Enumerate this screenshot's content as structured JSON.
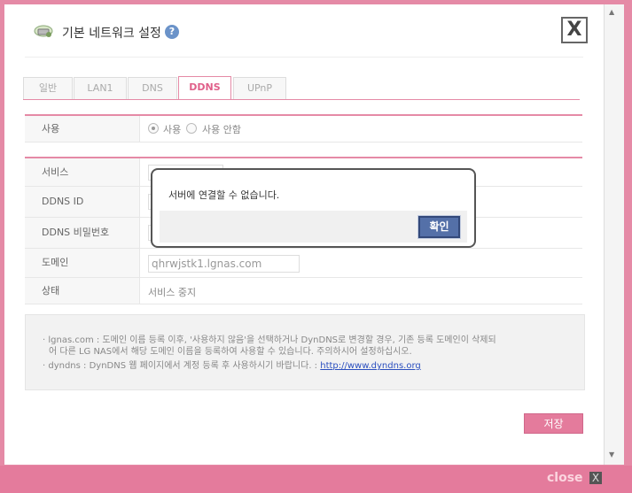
{
  "window": {
    "title": "기본 네트워크 설정",
    "help_label": "?",
    "close_x_label": "X",
    "footer_close_label": "close",
    "footer_close_x_label": "X"
  },
  "tabs": [
    {
      "label": "일반",
      "active": false
    },
    {
      "label": "LAN1",
      "active": false
    },
    {
      "label": "DNS",
      "active": false
    },
    {
      "label": "DDNS",
      "active": true
    },
    {
      "label": "UPnP",
      "active": false
    }
  ],
  "usage": {
    "label": "사용",
    "options": [
      {
        "label": "사용",
        "selected": true
      },
      {
        "label": "사용 안함",
        "selected": false
      }
    ]
  },
  "fields": {
    "service_label": "서비스",
    "ddns_id_label": "DDNS ID",
    "ddns_password_label": "DDNS 비밀번호",
    "domain_label": "도메인",
    "domain_value": "qhrwjstk1.lgnas.com",
    "status_label": "상태",
    "status_value": "서비스 중지"
  },
  "notes": {
    "note1_line1": "· lgnas.com : 도메인 이름 등록 이후, '사용하지 않음'을 선택하거나 DynDNS로 변경할 경우, 기존 등록 도메인이 삭제되",
    "note1_line2": "어 다른 LG NAS에서 해당 도메인 이름을 등록하여 사용할 수 있습니다. 주의하시어 설정하십시오.",
    "note2_text": "· dyndns : DynDNS 웹 페이지에서 계정 등록 후 사용하시기 바랍니다. : ",
    "note2_link": "http://www.dyndns.org"
  },
  "save_label": "저장",
  "dialog": {
    "message": "서버에 연결할 수 없습니다.",
    "ok_label": "확인"
  },
  "scrollbar": {
    "up_icon": "arrow-up-icon",
    "down_icon": "arrow-down-icon"
  }
}
